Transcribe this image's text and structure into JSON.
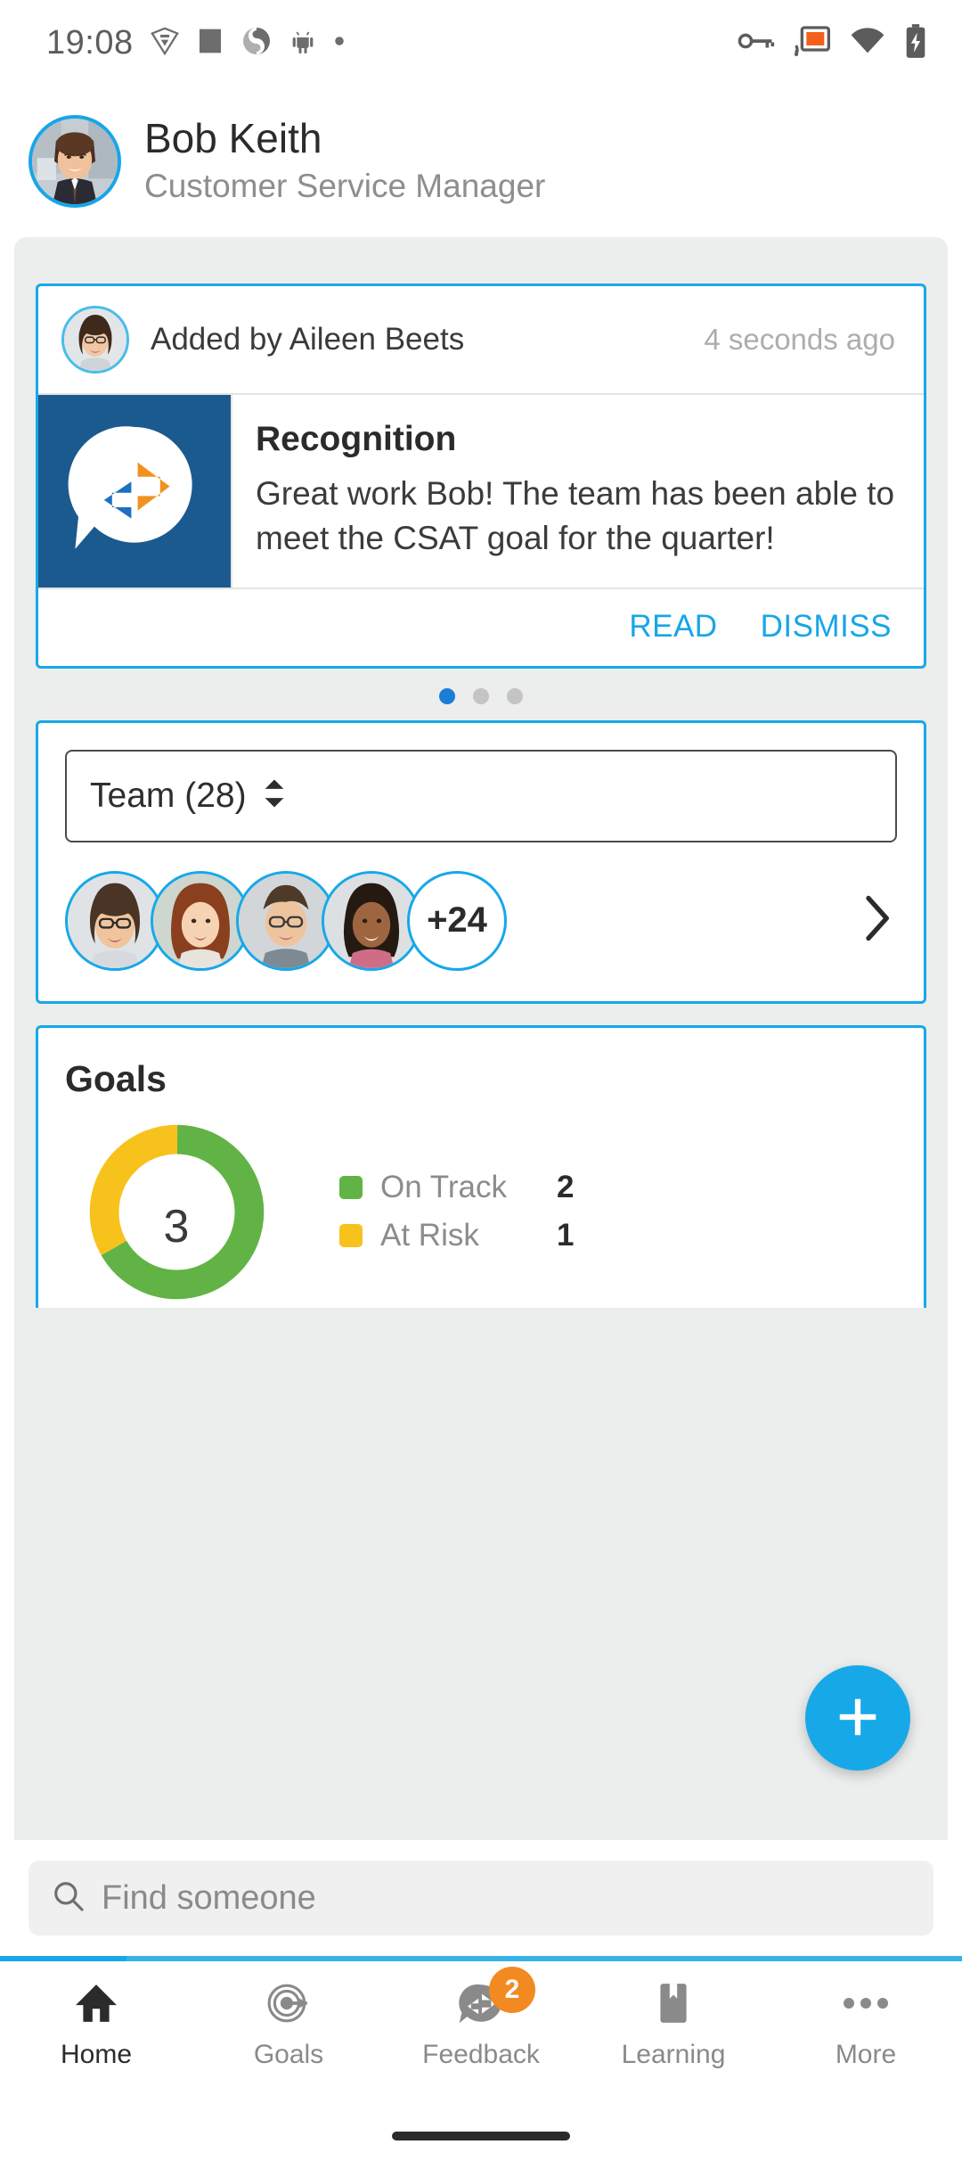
{
  "status_bar": {
    "time": "19:08",
    "left_icons": [
      "shield-icon",
      "square-icon",
      "spiral-icon",
      "android-icon",
      "dot-icon"
    ],
    "right_icons": [
      "vpn-key-icon",
      "cast-icon",
      "wifi-icon",
      "battery-charging-icon"
    ],
    "cast_color": "#f4601a"
  },
  "profile": {
    "name": "Bob Keith",
    "role": "Customer Service Manager",
    "avatar_name": "bob-keith-avatar"
  },
  "recognition_card": {
    "added_by": "Added by Aileen Beets",
    "timestamp": "4 seconds ago",
    "title": "Recognition",
    "message": "Great work Bob! The team has been able to meet the CSAT goal for the quarter!",
    "read_label": "READ",
    "dismiss_label": "DISMISS",
    "badge_bg": "#1b5a8f",
    "badge_arrow_orange": "#f2921e",
    "badge_arrow_blue": "#1c6fc1",
    "avatar_name": "aileen-beets-avatar"
  },
  "carousel": {
    "total_dots": 3,
    "active_index": 0,
    "active_color": "#1a7fd4",
    "inactive_color": "#c4c4c4"
  },
  "team_card": {
    "selector_label": "Team (28)",
    "member_count": 28,
    "overflow_label": "+24",
    "visible_avatars": [
      "team-avatar-1",
      "team-avatar-2",
      "team-avatar-3",
      "team-avatar-4"
    ],
    "chevron": "chevron-right-icon"
  },
  "goals_card": {
    "title": "Goals",
    "center_value": "3"
  },
  "chart_data": {
    "type": "pie",
    "title": "Goals",
    "center_label": "3",
    "categories": [
      "On Track",
      "At Risk"
    ],
    "values": [
      2,
      1
    ],
    "colors": [
      "#62b345",
      "#f7c21c"
    ],
    "legend_position": "right",
    "donut": true,
    "total": 3
  },
  "fab": {
    "icon": "plus-icon",
    "color": "#17a8e8"
  },
  "search": {
    "placeholder": "Find someone",
    "icon": "search-icon"
  },
  "bottom_nav": {
    "items": [
      {
        "label": "Home",
        "icon": "home-icon",
        "active": true,
        "badge": ""
      },
      {
        "label": "Goals",
        "icon": "target-icon",
        "active": false,
        "badge": ""
      },
      {
        "label": "Feedback",
        "icon": "feedback-icon",
        "active": false,
        "badge": "2"
      },
      {
        "label": "Learning",
        "icon": "bookmark-icon",
        "active": false,
        "badge": ""
      },
      {
        "label": "More",
        "icon": "ellipsis-icon",
        "active": false,
        "badge": ""
      }
    ],
    "badge_color": "#f28a21",
    "accent_color": "#17a8e8"
  }
}
